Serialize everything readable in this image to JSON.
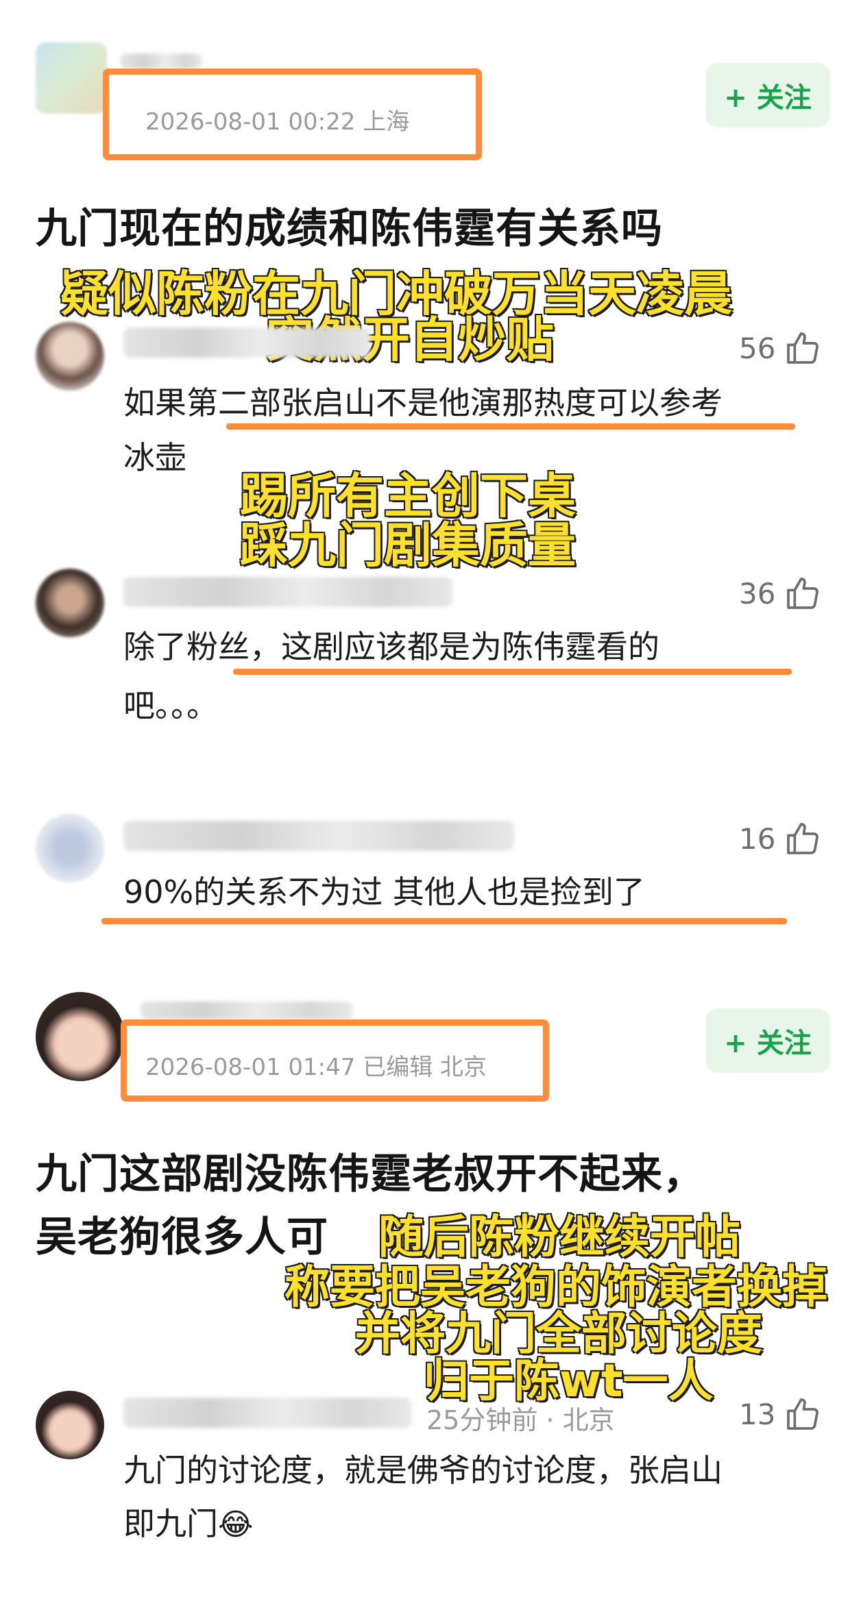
{
  "post1": {
    "meta": "2026-08-01 00:22  上海",
    "follow": "+ 关注",
    "title": "九门现在的成绩和陈伟霆有关系吗"
  },
  "captions": {
    "c1_line1": "疑似陈粉在九门冲破万当天凌晨",
    "c1_line2": "突然开自炒贴",
    "c2_line1": "踢所有主创下桌",
    "c2_line2": "踩九门剧集质量",
    "c3_line1": "随后陈粉继续开帖",
    "c3_line2": "称要把吴老狗的饰演者换掉",
    "c3_line3": "并将九门全部讨论度",
    "c3_line4": "归于陈wt一人"
  },
  "comments": [
    {
      "likes": "56",
      "text_line1": "如果第二部张启山不是他演那热度可以参考",
      "text_line2": "冰壶"
    },
    {
      "likes": "36",
      "text_line1": "除了粉丝，这剧应该都是为陈伟霆看的",
      "text_line2": "吧。。。"
    },
    {
      "likes": "16",
      "text_line1": "90%的关系不为过 其他人也是捡到了"
    }
  ],
  "post2": {
    "meta": "2026-08-01 01:47  已编辑  北京",
    "follow": "+ 关注",
    "title_line1": "九门这部剧没陈伟霆老叔开不起来，",
    "title_line2": "吴老狗很多人可"
  },
  "comment4": {
    "meta": "25分钟前 · 北京",
    "likes": "13",
    "text_line1": "九门的讨论度，就是佛爷的讨论度，张启山",
    "text_line2": "即九门",
    "emoji": "😂"
  },
  "colors": {
    "accent_orange": "#ff8c3a",
    "follow_green": "#17a34a",
    "caption_yellow": "#ffe12d"
  }
}
